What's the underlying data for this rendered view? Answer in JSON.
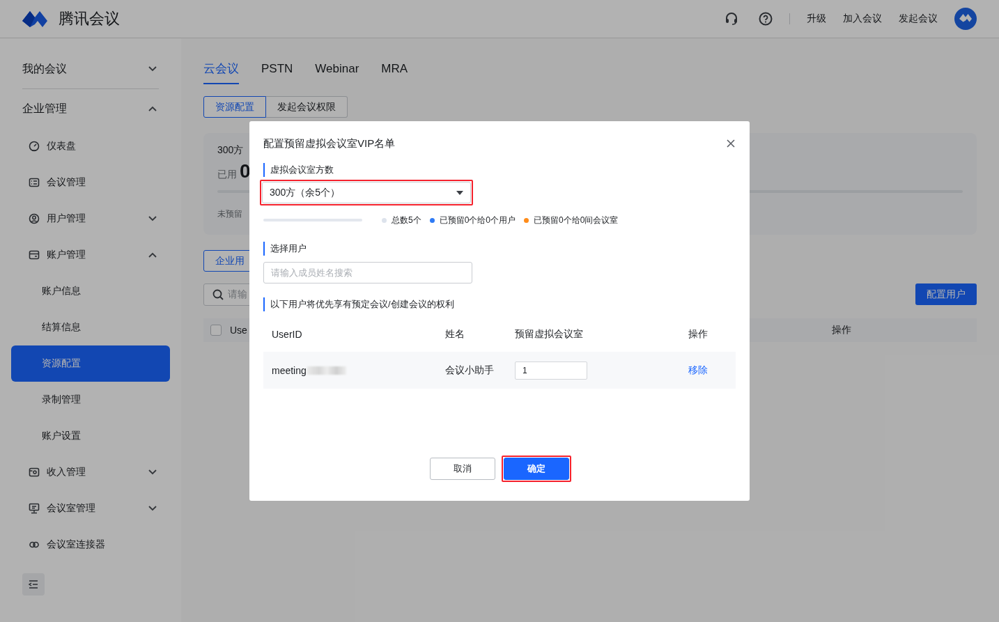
{
  "header": {
    "app_name": "腾讯会议",
    "links": [
      "升级",
      "加入会议",
      "发起会议"
    ]
  },
  "sidebar": {
    "items": [
      {
        "label": "我的会议",
        "selected": false,
        "expanded": false
      },
      {
        "label": "企业管理",
        "selected": false,
        "expanded": true,
        "children": [
          {
            "label": "仪表盘",
            "selected": false
          },
          {
            "label": "会议管理",
            "selected": false
          },
          {
            "label": "用户管理",
            "selected": false,
            "expanded": false
          },
          {
            "label": "账户管理",
            "selected": false,
            "expanded": true,
            "children": [
              {
                "label": "账户信息",
                "selected": false
              },
              {
                "label": "结算信息",
                "selected": false
              },
              {
                "label": "资源配置",
                "selected": true
              },
              {
                "label": "录制管理",
                "selected": false
              },
              {
                "label": "账户设置",
                "selected": false
              }
            ]
          },
          {
            "label": "收入管理",
            "selected": false,
            "expanded": false
          },
          {
            "label": "会议室管理",
            "selected": false,
            "expanded": false
          },
          {
            "label": "会议室连接器",
            "selected": false
          }
        ]
      }
    ]
  },
  "main": {
    "tabs": [
      {
        "label": "云会议",
        "selected": true
      },
      {
        "label": "PSTN",
        "selected": false
      },
      {
        "label": "Webinar",
        "selected": false
      },
      {
        "label": "MRA",
        "selected": false
      }
    ],
    "sub_tabs": [
      {
        "label": "资源配置",
        "selected": true
      },
      {
        "label": "发起会议权限",
        "selected": false
      }
    ],
    "summary": {
      "capacity": "300方",
      "used_label": "已用",
      "used_value": "0",
      "level": 0,
      "note": "未预留"
    },
    "member_button": "企业用",
    "search": {
      "placeholder": "请输"
    },
    "config_button": "配置用户",
    "table": {
      "checked": false,
      "columns": [
        "Use",
        "操作"
      ]
    }
  },
  "dialog": {
    "title": "配置预留虚拟会议室VIP名单",
    "capacity_label": "虚拟会议室方数",
    "capacity_select": {
      "value": "300方（余5个）",
      "highlighted": true
    },
    "usage": {
      "level": 0,
      "legend": [
        {
          "label": "总数5个",
          "color": "#dde3ec"
        },
        {
          "label": "已预留0个给0个用户",
          "color": "#2f7bf5"
        },
        {
          "label": "已预留0个给0间会议室",
          "color": "#ff8c1a"
        }
      ]
    },
    "user_label": "选择用户",
    "user_search": {
      "placeholder": "请输入成员姓名搜索"
    },
    "list_label": "以下用户将优先享有预定会议/创建会议的权利",
    "table": {
      "columns": [
        "UserID",
        "姓名",
        "预留虚拟会议室",
        "操作"
      ],
      "rows": [
        {
          "user_id": "meeting",
          "redacted": true,
          "name": "会议小助手",
          "rooms": "1",
          "action": "移除"
        }
      ]
    },
    "buttons": [
      {
        "label": "取消",
        "kind": "secondary",
        "highlighted": false
      },
      {
        "label": "确定",
        "kind": "primary",
        "highlighted": true
      }
    ]
  }
}
